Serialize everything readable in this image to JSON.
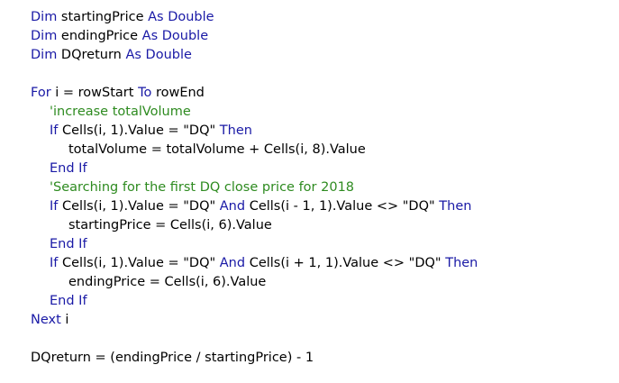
{
  "colors": {
    "keyword": "#1a1aa6",
    "comment": "#2e8b20",
    "text": "#000000",
    "background": "#ffffff"
  },
  "code_lines": [
    {
      "indent": 0,
      "tokens": [
        {
          "t": "kw",
          "s": "Dim"
        },
        {
          "t": "tx",
          "s": " startingPrice "
        },
        {
          "t": "kw",
          "s": "As Double"
        }
      ]
    },
    {
      "indent": 0,
      "tokens": [
        {
          "t": "kw",
          "s": "Dim"
        },
        {
          "t": "tx",
          "s": " endingPrice "
        },
        {
          "t": "kw",
          "s": "As Double"
        }
      ]
    },
    {
      "indent": 0,
      "tokens": [
        {
          "t": "kw",
          "s": "Dim"
        },
        {
          "t": "tx",
          "s": " DQreturn "
        },
        {
          "t": "kw",
          "s": "As Double"
        }
      ]
    },
    {
      "indent": 0,
      "tokens": []
    },
    {
      "indent": 0,
      "tokens": [
        {
          "t": "kw",
          "s": "For"
        },
        {
          "t": "tx",
          "s": " i = rowStart "
        },
        {
          "t": "kw",
          "s": "To"
        },
        {
          "t": "tx",
          "s": " rowEnd"
        }
      ]
    },
    {
      "indent": 1,
      "tokens": [
        {
          "t": "cm",
          "s": "'increase totalVolume"
        }
      ]
    },
    {
      "indent": 1,
      "tokens": [
        {
          "t": "kw",
          "s": "If"
        },
        {
          "t": "tx",
          "s": " Cells(i, 1).Value = \"DQ\" "
        },
        {
          "t": "kw",
          "s": "Then"
        }
      ]
    },
    {
      "indent": 2,
      "tokens": [
        {
          "t": "tx",
          "s": "totalVolume = totalVolume + Cells(i, 8).Value"
        }
      ]
    },
    {
      "indent": 1,
      "tokens": [
        {
          "t": "kw",
          "s": "End If"
        }
      ]
    },
    {
      "indent": 1,
      "tokens": [
        {
          "t": "cm",
          "s": "'Searching for the first DQ close price for 2018"
        }
      ]
    },
    {
      "indent": 1,
      "tokens": [
        {
          "t": "kw",
          "s": "If"
        },
        {
          "t": "tx",
          "s": " Cells(i, 1).Value = \"DQ\" "
        },
        {
          "t": "kw",
          "s": "And"
        },
        {
          "t": "tx",
          "s": " Cells(i - 1, 1).Value <> \"DQ\" "
        },
        {
          "t": "kw",
          "s": "Then"
        }
      ]
    },
    {
      "indent": 2,
      "tokens": [
        {
          "t": "tx",
          "s": "startingPrice = Cells(i, 6).Value"
        }
      ]
    },
    {
      "indent": 1,
      "tokens": [
        {
          "t": "kw",
          "s": "End If"
        }
      ]
    },
    {
      "indent": 1,
      "tokens": [
        {
          "t": "kw",
          "s": "If"
        },
        {
          "t": "tx",
          "s": " Cells(i, 1).Value = \"DQ\" "
        },
        {
          "t": "kw",
          "s": "And"
        },
        {
          "t": "tx",
          "s": " Cells(i + 1, 1).Value <> \"DQ\" "
        },
        {
          "t": "kw",
          "s": "Then"
        }
      ]
    },
    {
      "indent": 2,
      "tokens": [
        {
          "t": "tx",
          "s": "endingPrice = Cells(i, 6).Value"
        }
      ]
    },
    {
      "indent": 1,
      "tokens": [
        {
          "t": "kw",
          "s": "End If"
        }
      ]
    },
    {
      "indent": 0,
      "tokens": [
        {
          "t": "kw",
          "s": "Next"
        },
        {
          "t": "tx",
          "s": " i"
        }
      ]
    },
    {
      "indent": 0,
      "tokens": []
    },
    {
      "indent": 0,
      "tokens": [
        {
          "t": "tx",
          "s": "DQreturn = (endingPrice / startingPrice) - 1"
        }
      ]
    }
  ]
}
